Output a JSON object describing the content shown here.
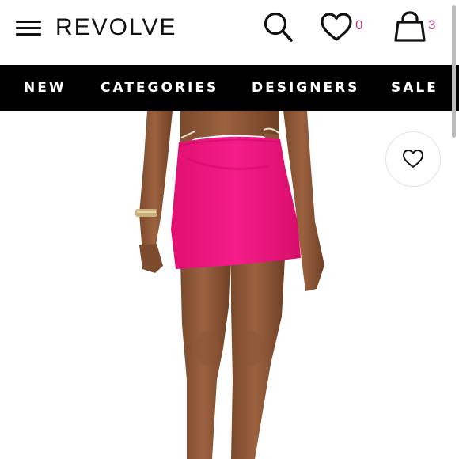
{
  "brand": {
    "name": "REVOLVE"
  },
  "header": {
    "menu_icon": "hamburger-menu-icon",
    "search_icon": "search-icon",
    "wishlist_icon": "heart-icon",
    "wishlist_count": "0",
    "bag_icon": "shopping-bag-icon",
    "bag_count": "3"
  },
  "nav": {
    "items": [
      "NEW",
      "CATEGORIES",
      "DESIGNERS",
      "SALE"
    ]
  },
  "product": {
    "image_subject": "model wearing hot pink mini skirt",
    "favorite_icon": "heart-outline-icon"
  },
  "colors": {
    "accent_count": "#c0397f",
    "nav_background": "#000000",
    "skirt": "#f01784"
  }
}
